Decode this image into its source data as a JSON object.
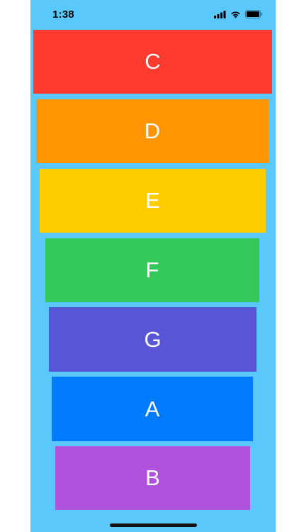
{
  "status_bar": {
    "time": "1:38",
    "icons": [
      "cellular-signal-icon",
      "wifi-icon",
      "battery-icon"
    ]
  },
  "keys": [
    {
      "label": "C",
      "color": "#ff3b30"
    },
    {
      "label": "D",
      "color": "#ff9500"
    },
    {
      "label": "E",
      "color": "#ffcc00"
    },
    {
      "label": "F",
      "color": "#34c759"
    },
    {
      "label": "G",
      "color": "#5856d6"
    },
    {
      "label": "A",
      "color": "#007aff"
    },
    {
      "label": "B",
      "color": "#af52de"
    }
  ],
  "background_color": "#5ac8fa"
}
